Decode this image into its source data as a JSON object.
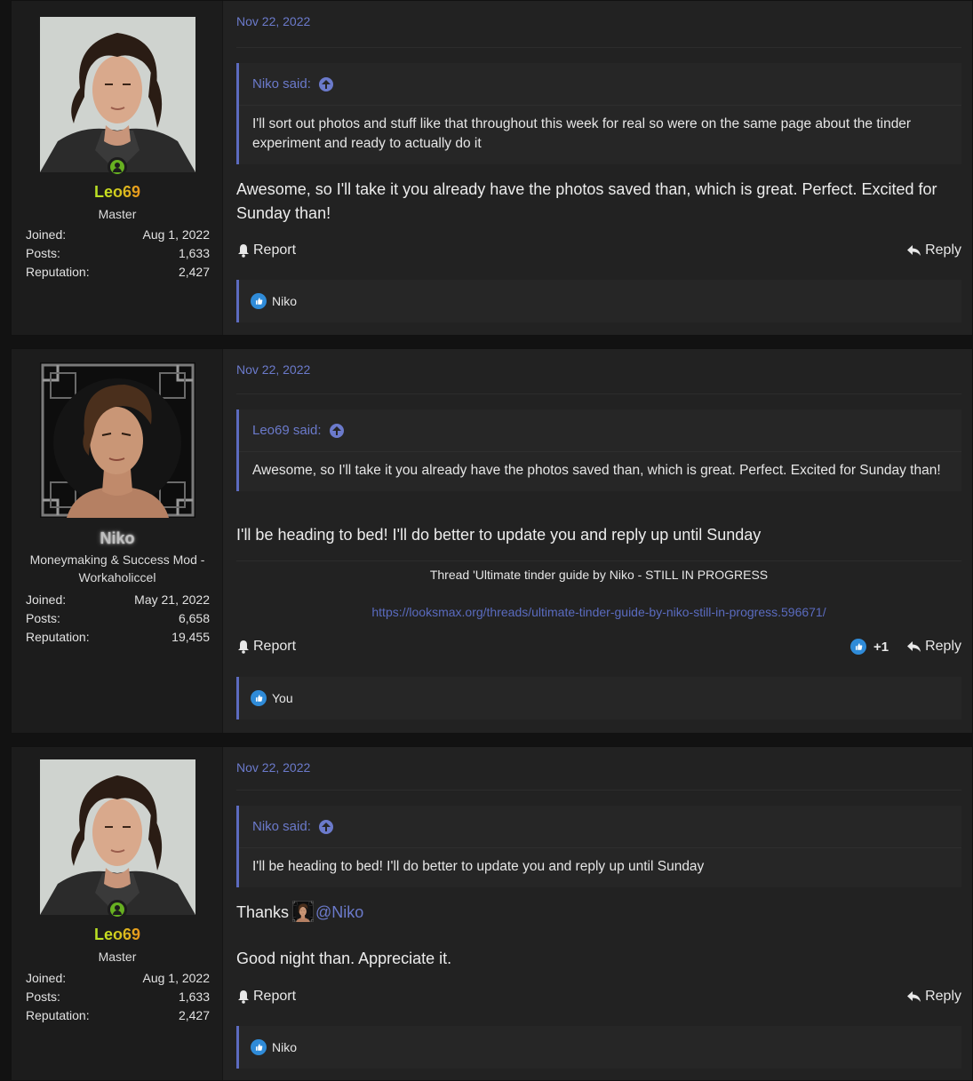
{
  "posts": [
    {
      "user": {
        "name": "Leo69",
        "title": "Master",
        "online": true,
        "stats": {
          "joined_label": "Joined:",
          "joined": "Aug 1, 2022",
          "posts_label": "Posts:",
          "posts": "1,633",
          "reputation_label": "Reputation:",
          "reputation": "2,427"
        }
      },
      "date": "Nov 22, 2022",
      "quote": {
        "author": "Niko said:",
        "text": "I'll sort out photos and stuff like that throughout this week for real so were on the same page about the tinder experiment and ready to actually do it"
      },
      "message": "Awesome, so I'll take it you already have the photos saved than, which is great. Perfect. Excited for Sunday than!",
      "actions": {
        "report": "Report",
        "reply": "Reply"
      },
      "reactions": "Niko"
    },
    {
      "user": {
        "name": "Niko",
        "title": "Moneymaking & Success Mod - Workaholiccel",
        "online": false,
        "stats": {
          "joined_label": "Joined:",
          "joined": "May 21, 2022",
          "posts_label": "Posts:",
          "posts": "6,658",
          "reputation_label": "Reputation:",
          "reputation": "19,455"
        }
      },
      "date": "Nov 22, 2022",
      "quote": {
        "author": "Leo69 said:",
        "text": "Awesome, so I'll take it you already have the photos saved than, which is great. Perfect. Excited for Sunday than!"
      },
      "message": "I'll be heading to bed! I'll do better to update you and reply up until Sunday",
      "signature": {
        "title": "Thread 'Ultimate tinder guide by Niko - STILL IN PROGRESS",
        "link": "https://looksmax.org/threads/ultimate-tinder-guide-by-niko-still-in-progress.596671/"
      },
      "actions": {
        "report": "Report",
        "plus": "+1",
        "reply": "Reply"
      },
      "reactions": "You"
    },
    {
      "user": {
        "name": "Leo69",
        "title": "Master",
        "online": true,
        "stats": {
          "joined_label": "Joined:",
          "joined": "Aug 1, 2022",
          "posts_label": "Posts:",
          "posts": "1,633",
          "reputation_label": "Reputation:",
          "reputation": "2,427"
        }
      },
      "date": "Nov 22, 2022",
      "quote": {
        "author": "Niko said:",
        "text": "I'll be heading to bed! I'll do better to update you and reply up until Sunday"
      },
      "message_thanks": "Thanks",
      "mention": "@Niko",
      "message2": "Good night than. Appreciate it.",
      "actions": {
        "report": "Report",
        "reply": "Reply"
      },
      "reactions": "Niko"
    }
  ],
  "colors": {
    "background": "#121212",
    "post_bg": "#222222",
    "sidebar_bg": "#1c1c1c",
    "accent": "#6b7acb",
    "online": "#67b021",
    "like": "#2f8bd8"
  }
}
